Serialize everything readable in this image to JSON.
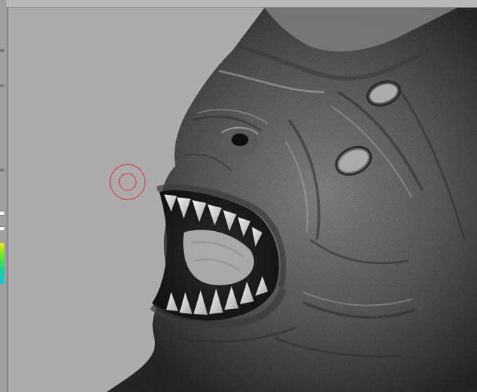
{
  "app": {
    "mode": "sculpt",
    "model": "creature head",
    "colors": {
      "canvas_background": "#acacac",
      "brush_cursor": "#e53a3a",
      "panel": "#a0a0a0"
    }
  },
  "tools": {
    "brush_cursor_icon": "brush-circle-icon",
    "color_picker_icon": "color-gradient-icon"
  }
}
